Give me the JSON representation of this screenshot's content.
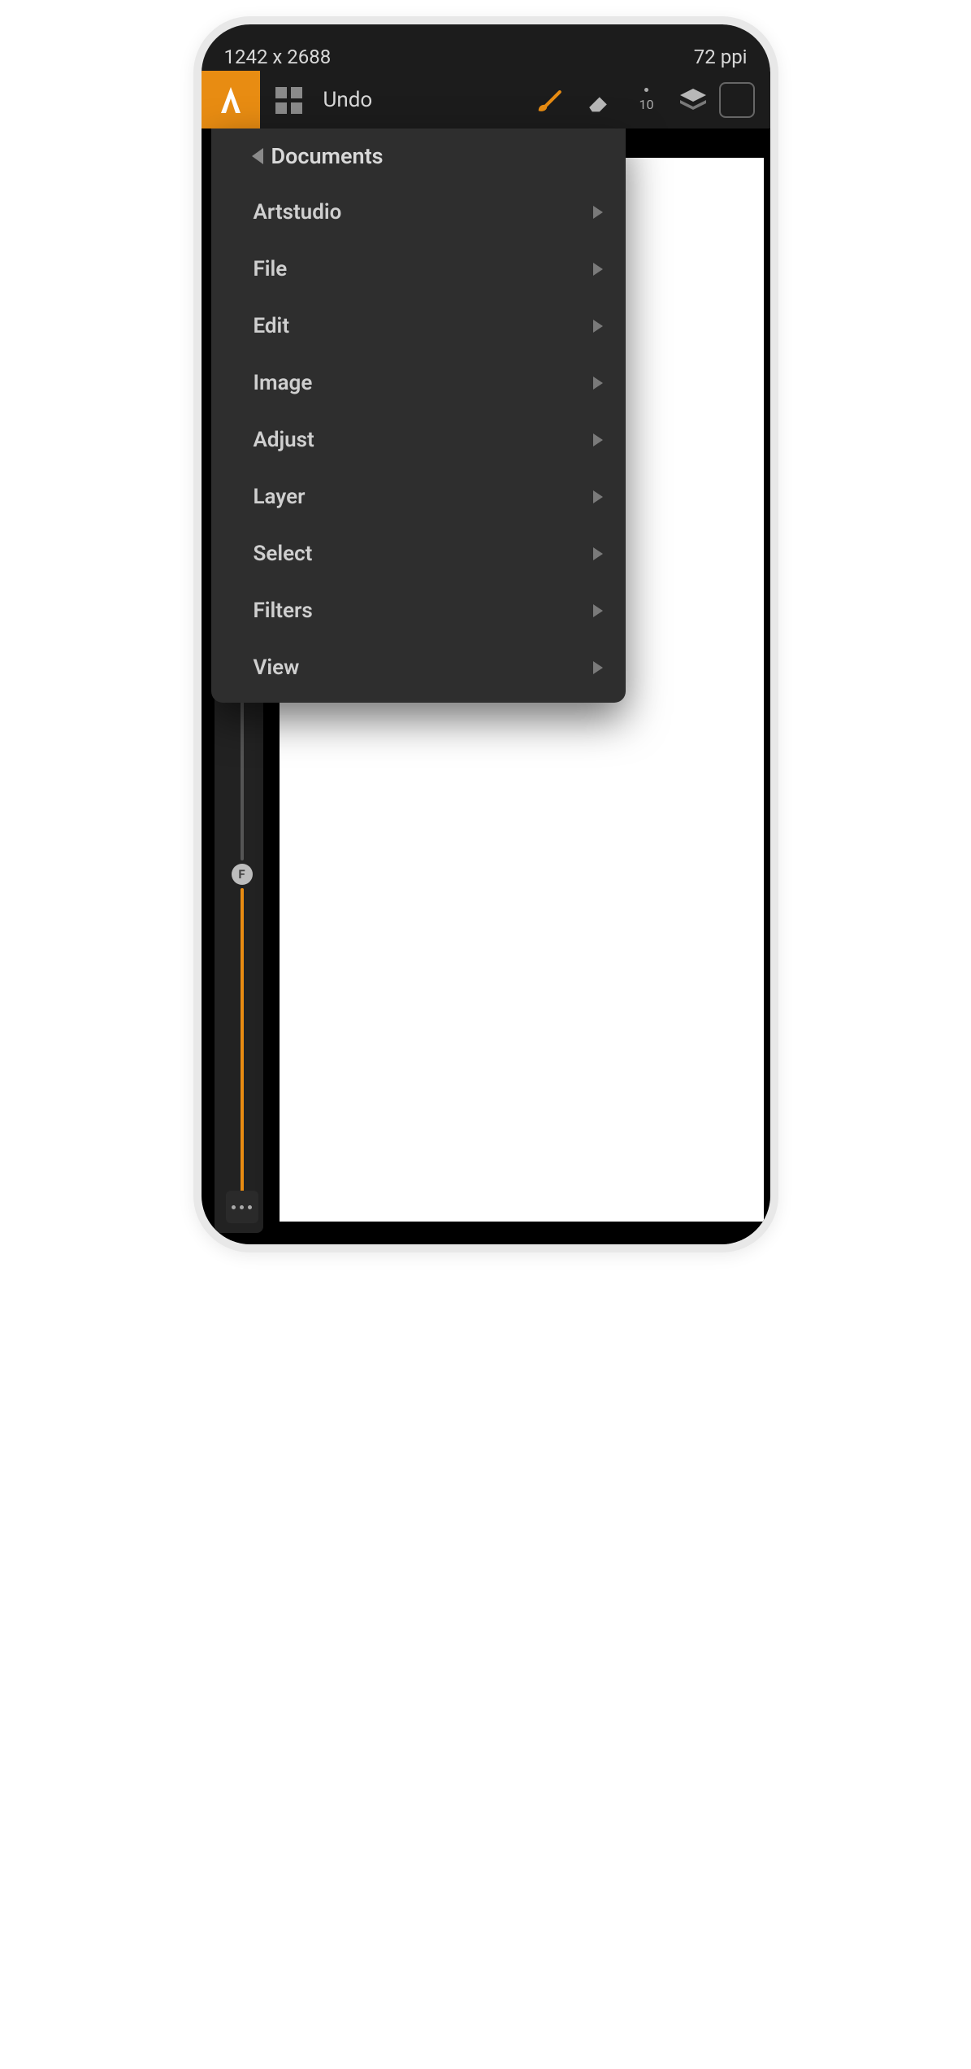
{
  "statusbar": {
    "dimensions": "1242 x 2688",
    "ppi": "72 ppi"
  },
  "toolbar": {
    "undo_label": "Undo",
    "brush_size": "10"
  },
  "slider": {
    "handle_label": "F"
  },
  "menu": {
    "header": "Documents",
    "items": [
      {
        "label": "Artstudio"
      },
      {
        "label": "File"
      },
      {
        "label": "Edit"
      },
      {
        "label": "Image"
      },
      {
        "label": "Adjust"
      },
      {
        "label": "Layer"
      },
      {
        "label": "Select"
      },
      {
        "label": "Filters"
      },
      {
        "label": "View"
      }
    ]
  }
}
